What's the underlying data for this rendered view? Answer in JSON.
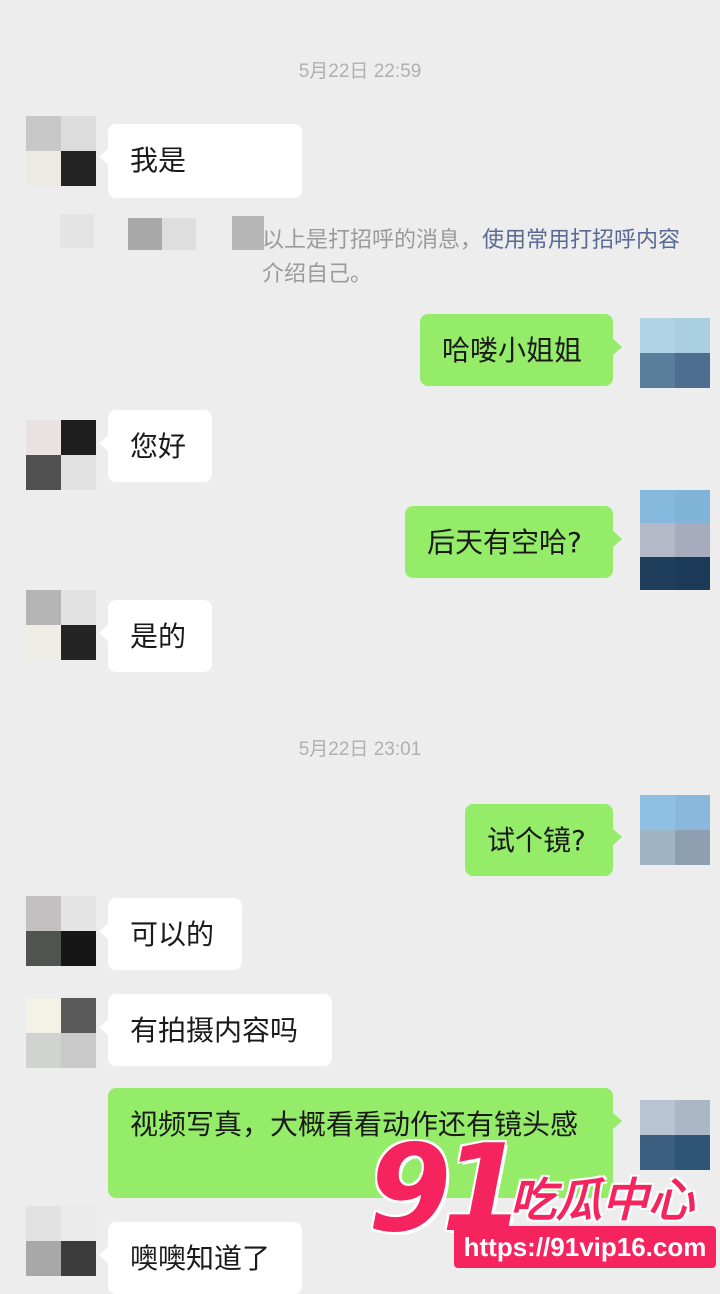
{
  "timestamps": [
    "5月22日 22:59",
    "5月22日 23:01"
  ],
  "system_notice": {
    "prefix": "以上是打招呼的消息，",
    "link_text": "使用常用打招呼内容",
    "suffix": "介绍自己。"
  },
  "messages": [
    {
      "side": "in",
      "text": "我是"
    },
    {
      "side": "out",
      "text": "哈喽小姐姐"
    },
    {
      "side": "in",
      "text": "您好"
    },
    {
      "side": "out",
      "text": "后天有空哈?"
    },
    {
      "side": "in",
      "text": "是的"
    },
    {
      "side": "out",
      "text": "试个镜?"
    },
    {
      "side": "in",
      "text": "可以的"
    },
    {
      "side": "in",
      "text": "有拍摄内容吗"
    },
    {
      "side": "out",
      "text": "视频写真，大概看看动作还有镜头感"
    },
    {
      "side": "in",
      "text": "噢噢知道了"
    }
  ],
  "watermark": {
    "number": "91",
    "chinese": "吃瓜中心",
    "url": "https://91vip16.com"
  },
  "colors": {
    "background": "#ededed",
    "incoming_bubble": "#ffffff",
    "outgoing_bubble": "#95ec69",
    "link": "#576b95",
    "watermark": "#f5245f"
  },
  "icons": {
    "contact_avatar": "pixelated-avatar",
    "self_avatar": "pixelated-avatar-blue"
  }
}
